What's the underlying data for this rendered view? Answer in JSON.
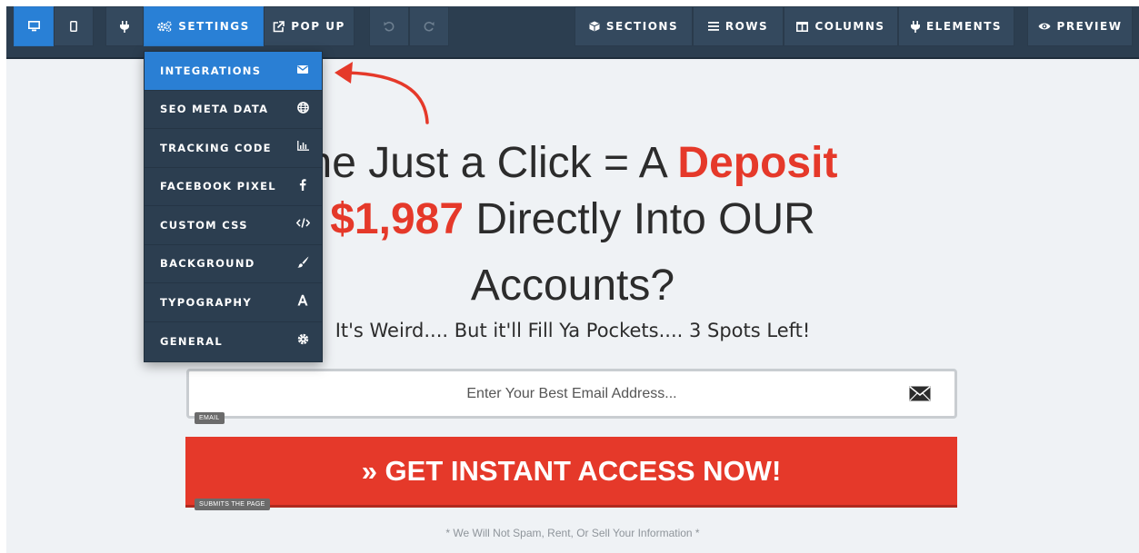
{
  "toolbar": {
    "desktop_icon": "desktop-icon",
    "mobile_icon": "mobile-icon",
    "plugin_icon": "plug-icon",
    "settings_label": "SETTINGS",
    "popup_label": "POP UP",
    "undo_icon": "undo-icon",
    "redo_icon": "redo-icon",
    "sections_label": "SECTIONS",
    "rows_label": "ROWS",
    "columns_label": "COLUMNS",
    "elements_label": "ELEMENTS",
    "preview_label": "PREVIEW"
  },
  "settings_menu": {
    "items": [
      {
        "label": "INTEGRATIONS",
        "icon": "envelope-icon"
      },
      {
        "label": "SEO META DATA",
        "icon": "globe-icon"
      },
      {
        "label": "TRACKING CODE",
        "icon": "bar-chart-icon"
      },
      {
        "label": "FACEBOOK PIXEL",
        "icon": "facebook-icon"
      },
      {
        "label": "CUSTOM CSS",
        "icon": "code-icon"
      },
      {
        "label": "BACKGROUND",
        "icon": "brush-icon"
      },
      {
        "label": "TYPOGRAPHY",
        "icon": "font-icon"
      },
      {
        "label": "GENERAL",
        "icon": "gear-icon"
      }
    ]
  },
  "page": {
    "headline_line1_a": "ne Just a Click = A ",
    "headline_line1_b": "Deposit",
    "headline_line2_a": "$1,987",
    "headline_line2_b": " Directly Into OUR",
    "headline_line3": "Accounts?",
    "subheadline": "It's Weird.... But it'll Fill Ya Pockets.... 3 Spots Left!",
    "email_placeholder": "Enter Your Best Email Address...",
    "email_tag": "EMAIL",
    "cta_label": "» GET INSTANT ACCESS NOW!",
    "cta_tag": "SUBMITS THE PAGE",
    "disclaimer": "* We Will Not Spam, Rent, Or Sell Your Information *"
  },
  "colors": {
    "toolbar_bg": "#2c3e50",
    "active_blue": "#2980d6",
    "accent_red": "#e5392a"
  }
}
